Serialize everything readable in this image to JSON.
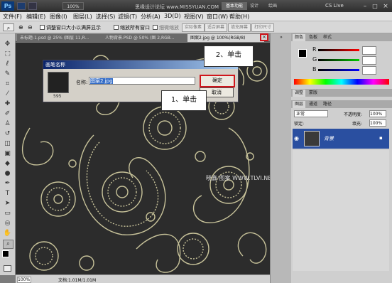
{
  "titlebar": {
    "app_icon": "Ps",
    "zoom_field": "100%",
    "workspace_buttons": [
      "基本功能",
      "设计",
      "绘画"
    ],
    "cslive": "CS Live",
    "watermark": "思缘设计论坛 www.MISSYUAN.COM"
  },
  "menu": [
    "文件(F)",
    "编辑(E)",
    "图像(I)",
    "图层(L)",
    "选择(S)",
    "滤镜(T)",
    "分析(A)",
    "3D(D)",
    "视图(V)",
    "窗口(W)",
    "帮助(H)"
  ],
  "options": {
    "checkbox1": "调整窗口大小以满屏显示",
    "checkbox2": "缩放所有窗口",
    "scrubby": "细微缩放",
    "buttons": [
      "实际像素",
      "适合屏幕",
      "填充屏幕",
      "打印尺寸"
    ]
  },
  "tabs": [
    "未标题-1.psd @ 25% (图层 11,R...",
    "人物背景.PSD @ 50% (图 2,RGB...",
    "图案2.jpg @ 100%(RGB/8)"
  ],
  "status": {
    "zoom": "100%",
    "doc": "文档:1.01M/1.01M"
  },
  "dialog": {
    "title": "画笔名称",
    "name_label": "名称:",
    "name_value": "图案2.jpg",
    "preview_size": "595",
    "ok": "确定",
    "cancel": "取消"
  },
  "callouts": {
    "one": "1、单击",
    "two": "2、单击"
  },
  "canvas_watermark": "晓鑫·图案 WWW.TLVI.NET",
  "color_panel": {
    "tabs": [
      "颜色",
      "色板",
      "样式"
    ],
    "rows": [
      "R",
      "G",
      "B"
    ]
  },
  "adjust_panel": {
    "tabs": [
      "调整",
      "蒙版"
    ]
  },
  "layers_panel": {
    "tabs": [
      "图层",
      "通道",
      "路径"
    ],
    "blend": "正常",
    "opacity_label": "不透明度:",
    "opacity": "100%",
    "lock_label": "锁定:",
    "fill_label": "填充:",
    "fill": "100%",
    "layer_name": "背景"
  },
  "colors": {
    "accent_red": "#d0151c",
    "layer_select": "#2a4fa0",
    "pattern": "#c8c39a"
  }
}
